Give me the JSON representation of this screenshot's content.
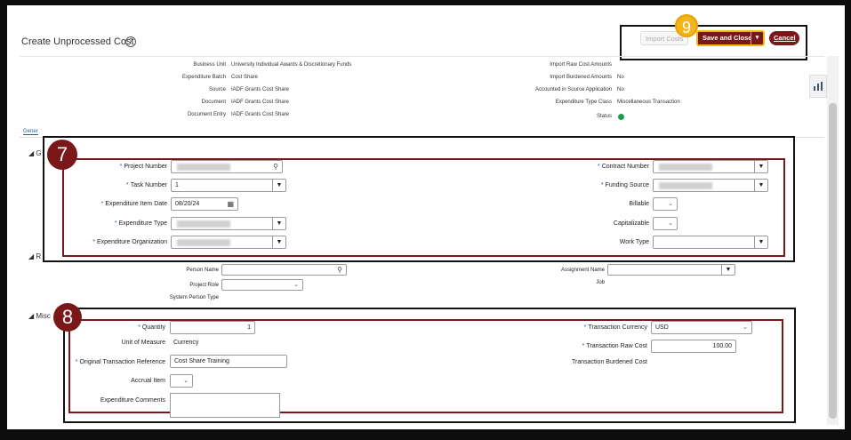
{
  "page": {
    "title": "Create Unprocessed Cost",
    "help": "?"
  },
  "toolbar": {
    "import_label": "Import Costs",
    "save_label": "Save and Close",
    "save_caret": "▾",
    "cancel_label": "Cancel"
  },
  "callouts": {
    "nine": "9",
    "seven": "7",
    "eight": "8"
  },
  "side_tab_icon": "bar-chart-icon",
  "header": {
    "left": [
      {
        "label": "Business Unit",
        "value": "University Individual Awards & Discretionary Funds"
      },
      {
        "label": "Expenditure Batch",
        "value": "Cost Share"
      },
      {
        "label": "Source",
        "value": "IADF Grants Cost Share"
      },
      {
        "label": "Document",
        "value": "IADF Grants Cost Share"
      },
      {
        "label": "Document Entry",
        "value": "IADF Grants Cost Share"
      }
    ],
    "right": [
      {
        "label": "Import Raw Cost Amounts",
        "value": ""
      },
      {
        "label": "Import Burdened Amounts",
        "value": "No"
      },
      {
        "label": "Accounted in Source Application",
        "value": "No"
      },
      {
        "label": "Expenditure Type Class",
        "value": "Miscellaneous Transaction"
      }
    ],
    "status_label": "Status"
  },
  "tabs": {
    "general": "Gener"
  },
  "sections": {
    "s1": "◢ G",
    "s2": "◢ R",
    "s3": "◢ Misc"
  },
  "project_section": {
    "project_number": {
      "label": "Project Number",
      "value": ""
    },
    "task_number": {
      "label": "Task Number",
      "value": "1"
    },
    "item_date": {
      "label": "Expenditure Item Date",
      "value": "08/20/24"
    },
    "expenditure_type": {
      "label": "Expenditure Type",
      "value": ""
    },
    "expenditure_org": {
      "label": "Expenditure Organization",
      "value": ""
    },
    "contract_number": {
      "label": "Contract Number",
      "value": ""
    },
    "funding_source": {
      "label": "Funding Source",
      "value": ""
    },
    "billable": {
      "label": "Billable",
      "value": ""
    },
    "capitalizable": {
      "label": "Capitalizable",
      "value": ""
    },
    "work_type": {
      "label": "Work Type",
      "value": ""
    }
  },
  "resource_section": {
    "person_name": {
      "label": "Person Name",
      "value": ""
    },
    "project_role": {
      "label": "Project Role",
      "value": ""
    },
    "person_type": {
      "label": "System Person Type"
    },
    "assignment_name": {
      "label": "Assignment Name",
      "value": ""
    },
    "job": {
      "label": "Job"
    }
  },
  "misc_section": {
    "quantity": {
      "label": "Quantity",
      "value": "1"
    },
    "unit_of_measure": {
      "label": "Unit of Measure",
      "value": "Currency"
    },
    "orig_ref": {
      "label": "Original Transaction Reference",
      "value": "Cost Share Training"
    },
    "accrual_item": {
      "label": "Accrual Item",
      "value": ""
    },
    "comments": {
      "label": "Expenditure Comments",
      "value": ""
    },
    "txn_currency": {
      "label": "Transaction Currency",
      "value": "USD"
    },
    "txn_raw_cost": {
      "label": "Transaction Raw Cost",
      "value": "100.00"
    },
    "txn_burdened": {
      "label": "Transaction Burdened Cost"
    }
  },
  "glyphs": {
    "search": "⚲",
    "dropdown": "▼",
    "chevron": "⌄",
    "calendar": "▦"
  }
}
